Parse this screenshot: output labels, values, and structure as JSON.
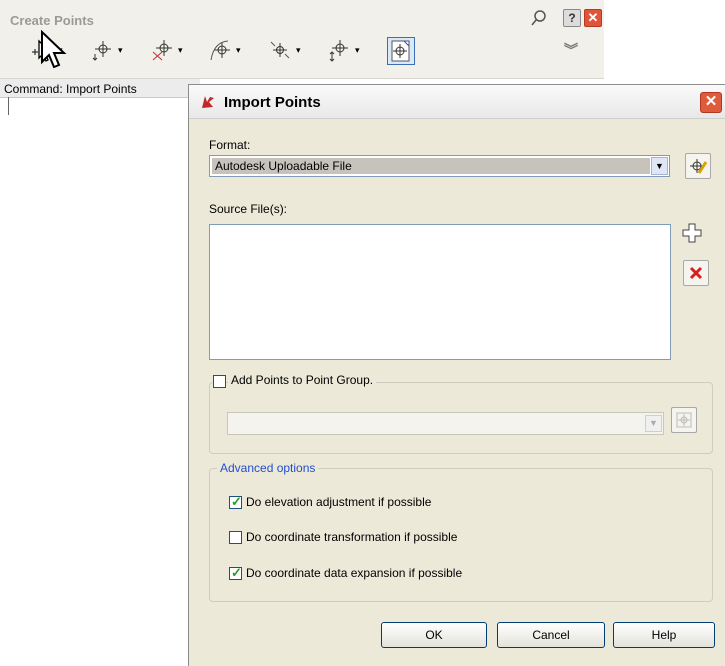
{
  "toolbar": {
    "title": "Create Points",
    "help_label": "?",
    "close_label": "✕",
    "more_label": "︾",
    "tools": [
      {
        "icon": "point-create-icon"
      },
      {
        "icon": "point-insert-icon"
      },
      {
        "icon": "point-intersection-icon"
      },
      {
        "icon": "point-alignment-icon"
      },
      {
        "icon": "point-surface-icon"
      },
      {
        "icon": "point-interpolate-icon"
      },
      {
        "icon": "point-import-icon"
      }
    ],
    "dropdown_caret": "▾"
  },
  "command": {
    "text": "Command: Import Points"
  },
  "dialog": {
    "title": "Import Points",
    "close_label": "✕",
    "format": {
      "label": "Format:",
      "value": "Autodesk Uploadable File",
      "dropdown_glyph": "▼"
    },
    "source": {
      "label": "Source File(s):",
      "files": []
    },
    "point_group": {
      "checkbox_label": "Add Points to Point Group.",
      "checked": false,
      "value": "",
      "dropdown_glyph": "▼"
    },
    "advanced": {
      "caption": "Advanced options",
      "options": [
        {
          "label": "Do elevation adjustment if possible",
          "checked": true
        },
        {
          "label": "Do coordinate transformation if possible",
          "checked": false
        },
        {
          "label": "Do coordinate data expansion if possible",
          "checked": true
        }
      ],
      "check_glyph": "✓"
    },
    "buttons": {
      "ok": "OK",
      "cancel": "Cancel",
      "help": "Help"
    }
  },
  "colors": {
    "accent_blue": "#1f4fd1",
    "titlebar_close": "#e05a3c",
    "check_green": "#21a121"
  }
}
